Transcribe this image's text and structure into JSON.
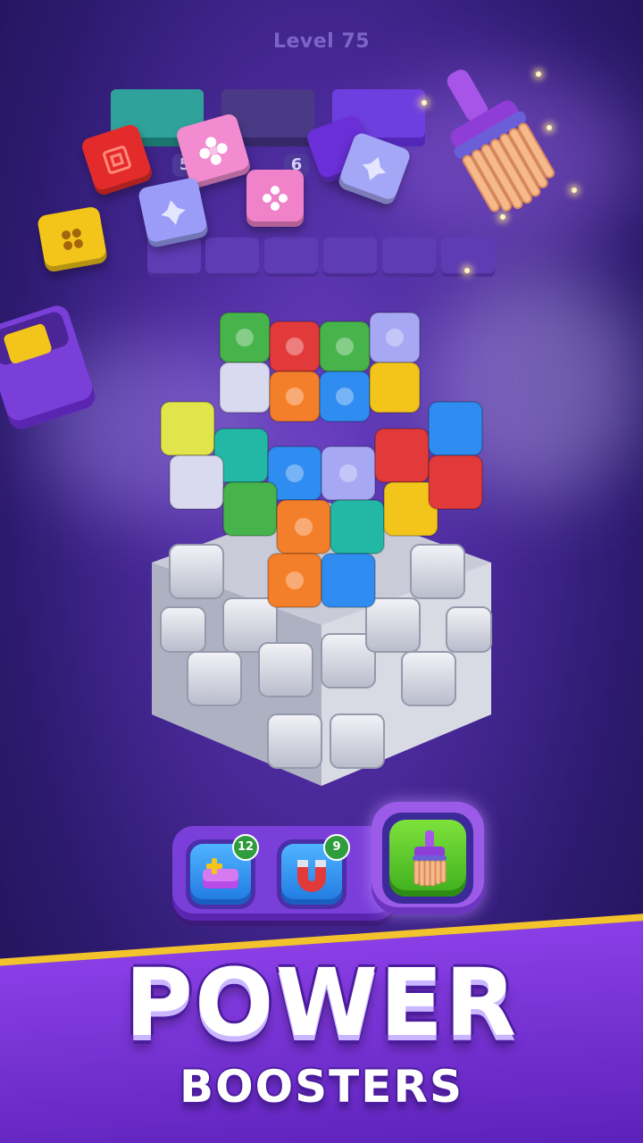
{
  "level": {
    "label": "Level 75"
  },
  "tray": {
    "counts": [
      "5",
      "6"
    ]
  },
  "boosters": [
    {
      "name": "add-slot",
      "count": "12"
    },
    {
      "name": "magnet",
      "count": "9"
    },
    {
      "name": "broom",
      "count": ""
    }
  ],
  "banner": {
    "title": "POWER",
    "subtitle": "BOOSTERS"
  },
  "colors": {
    "background": "#4a2a9a",
    "accent": "#7b3fd9",
    "stripe": "#f3c32d",
    "active": "#3cae1d"
  },
  "icons": [
    "broom-icon",
    "magnet-icon",
    "add-slot-icon",
    "box-icon"
  ]
}
